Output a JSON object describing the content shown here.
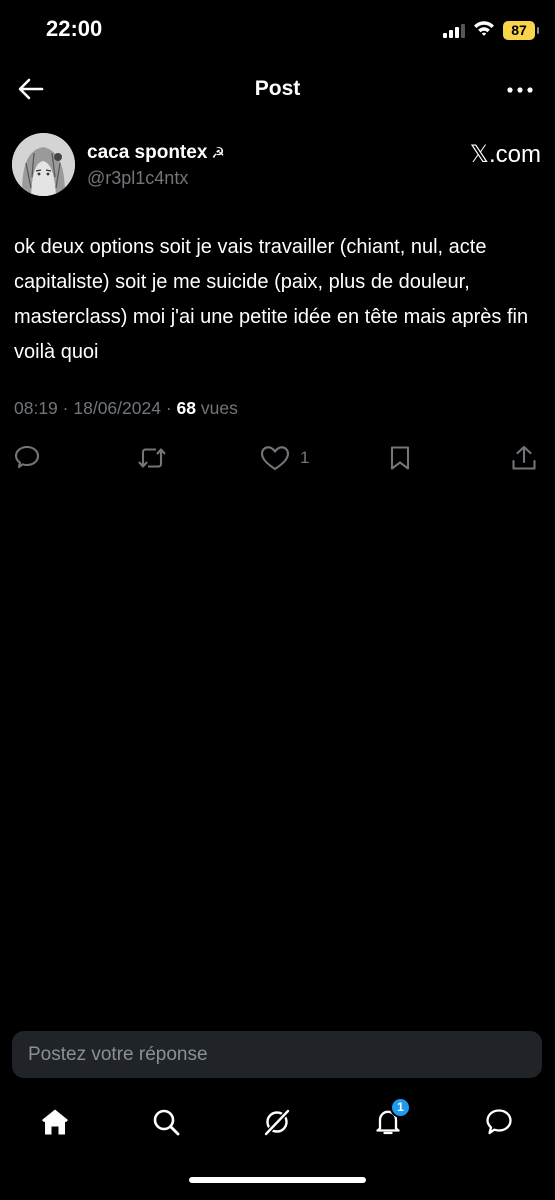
{
  "status_bar": {
    "time": "22:00",
    "battery": "87"
  },
  "header": {
    "title": "Post"
  },
  "post": {
    "author": {
      "name": "caca spontex",
      "name_glyph": "☭",
      "handle": "@r3pl1c4ntx"
    },
    "source_label": "𝕏.com",
    "text": "ok deux options soit je vais travailler (chiant, nul, acte capitaliste) soit je me suicide (paix, plus de douleur, masterclass) moi j'ai une petite idée en tête mais après fin voilà quoi",
    "meta": {
      "time": "08:19",
      "separator": "·",
      "date": "18/06/2024",
      "views_count": "68",
      "views_label": "vues"
    },
    "actions": {
      "like_count": "1"
    }
  },
  "reply": {
    "placeholder": "Postez votre réponse"
  },
  "nav": {
    "notifications_badge": "1"
  },
  "icons": {
    "back": "arrow-left-icon",
    "more": "more-horizontal-icon",
    "reply": "comment-icon",
    "repost": "repost-icon",
    "like": "heart-icon",
    "bookmark": "bookmark-icon",
    "share": "share-icon",
    "home": "home-icon",
    "search": "search-icon",
    "grok": "grok-icon",
    "notifications": "bell-icon",
    "messages": "message-icon"
  },
  "colors": {
    "background": "#000000",
    "secondary_text": "#71767b",
    "accent": "#1d9bf0",
    "battery": "#f7d44a"
  }
}
